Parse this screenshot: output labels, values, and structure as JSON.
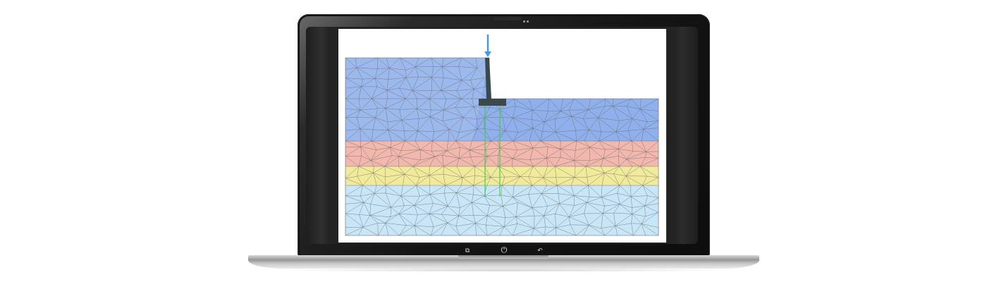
{
  "device": {
    "type": "laptop",
    "bezel_color": "#161616",
    "base_color": "#b8b8b8"
  },
  "screen": {
    "content": "finite-element-mesh",
    "load_arrow_color": "#3f9be8",
    "footing_color": "#3a4a4a",
    "pile_color": "#3ed04a",
    "mesh_line_color": "#6d6d6d",
    "layers": [
      {
        "name": "layer-1",
        "color": "#8fb0ec"
      },
      {
        "name": "layer-2",
        "color": "#f2b7ad"
      },
      {
        "name": "layer-3",
        "color": "#f2ea9b"
      },
      {
        "name": "layer-4",
        "color": "#c8e6f8"
      }
    ]
  },
  "taskbar": {
    "buttons": [
      {
        "name": "recent-apps",
        "icon": "recent-apps-icon",
        "glyph": "⧉"
      },
      {
        "name": "power",
        "icon": "power-icon",
        "glyph": "⏻"
      },
      {
        "name": "back",
        "icon": "back-arrow-icon",
        "glyph": "↶"
      }
    ]
  }
}
